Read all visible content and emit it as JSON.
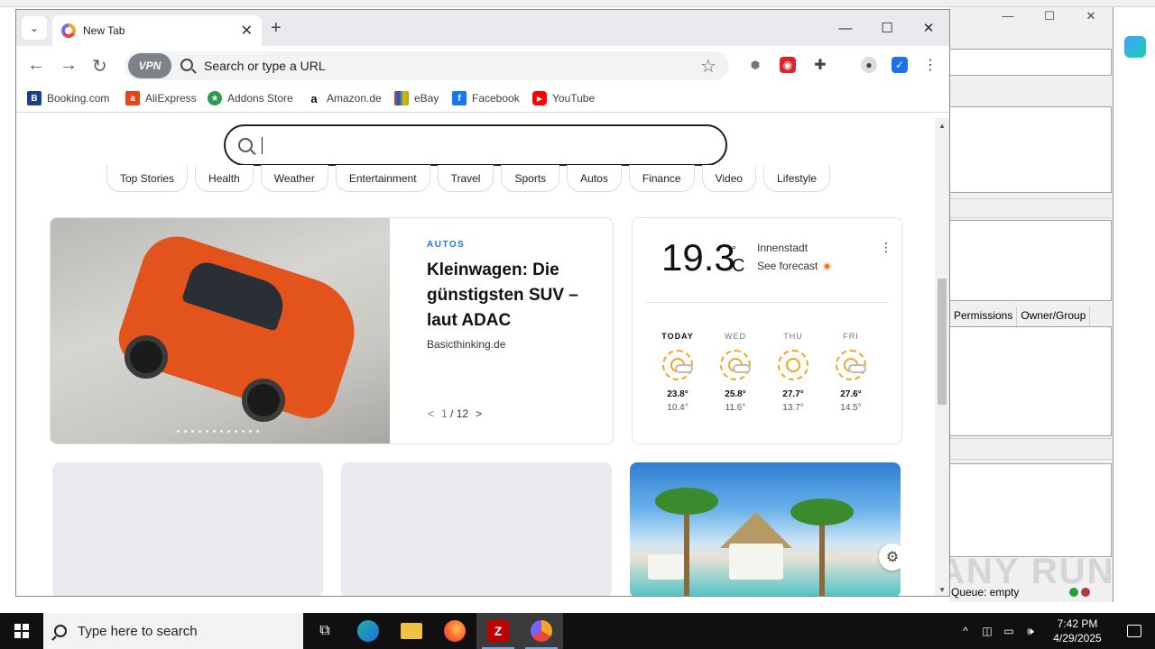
{
  "browser": {
    "tab_title": "New Tab",
    "omnibox_placeholder": "Search or type a URL",
    "vpn_label": "VPN",
    "bookmarks": [
      {
        "label": "Booking.com",
        "icon": "booking-icon",
        "color": "#1d3f88"
      },
      {
        "label": "AliExpress",
        "icon": "aliexpress-icon",
        "color": "#e8431a"
      },
      {
        "label": "Addons Store",
        "icon": "addons-store-icon",
        "color": "#2e9a4b"
      },
      {
        "label": "Amazon.de",
        "icon": "amazon-icon",
        "color": "#111111"
      },
      {
        "label": "eBay",
        "icon": "ebay-icon",
        "color": "#e53238"
      },
      {
        "label": "Facebook",
        "icon": "facebook-icon",
        "color": "#1877f2"
      },
      {
        "label": "YouTube",
        "icon": "youtube-icon",
        "color": "#ff0000"
      }
    ]
  },
  "newtab": {
    "pills": [
      "Top Stories",
      "Health",
      "Weather",
      "Entertainment",
      "Travel",
      "Sports",
      "Autos",
      "Finance",
      "Video",
      "Lifestyle"
    ],
    "news": {
      "category": "AUTOS",
      "title": "Kleinwagen: Die günstigsten SUV – laut ADAC",
      "source": "Basicthinking.de",
      "pager_current": "1",
      "pager_total": "/ 12",
      "prev": "<",
      "next": ">"
    },
    "weather": {
      "temp": "19.3",
      "unit_deg": "°",
      "unit_c": "C",
      "location": "Innenstadt",
      "forecast_label": "See forecast",
      "days": [
        {
          "name": "TODAY",
          "hi": "23.8°",
          "lo": "10.4°",
          "icon": "partly-cloudy-icon"
        },
        {
          "name": "WED",
          "hi": "25.8°",
          "lo": "11.6°",
          "icon": "partly-cloudy-icon"
        },
        {
          "name": "THU",
          "hi": "27.7°",
          "lo": "13.7°",
          "icon": "sunny-icon"
        },
        {
          "name": "FRI",
          "hi": "27.6°",
          "lo": "14.5°",
          "icon": "partly-cloudy-icon"
        }
      ]
    }
  },
  "background_app": {
    "col_permissions": "Permissions",
    "col_owner": "Owner/Group",
    "queue": "Queue: empty"
  },
  "taskbar": {
    "search_placeholder": "Type here to search",
    "time": "7:42 PM",
    "date": "4/29/2025"
  },
  "watermark": "ANY RUN"
}
